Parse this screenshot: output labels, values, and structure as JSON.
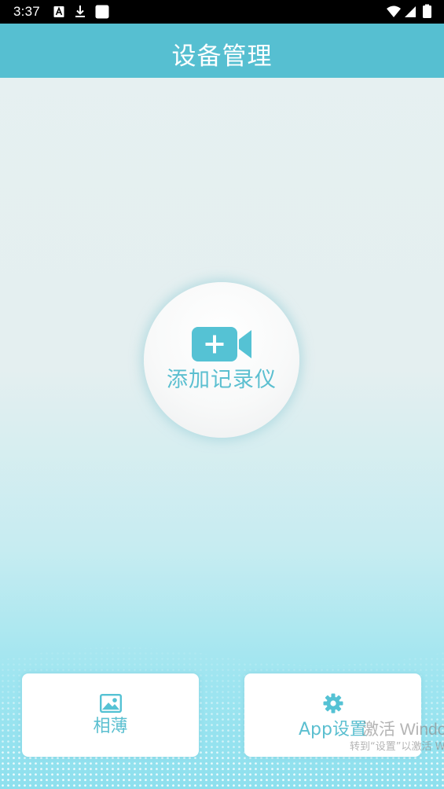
{
  "status_bar": {
    "time": "3:37",
    "left_icons": [
      "font-notification-icon",
      "download-icon",
      "square-notification-icon"
    ],
    "right_icons": [
      "wifi-icon",
      "cellular-signal-icon",
      "battery-icon"
    ]
  },
  "header": {
    "title": "设备管理"
  },
  "add_device": {
    "label": "添加记录仪",
    "icon": "video-camera-add-icon"
  },
  "bottom_nav": {
    "album_label": "相薄",
    "album_icon": "image-icon",
    "settings_label": "App设置",
    "settings_icon": "gear-icon"
  },
  "watermark": {
    "line1": "激活 Windows",
    "line2": "转到“设置”以激活 Windows。"
  },
  "colors": {
    "header_bg": "#56bfd1",
    "accent": "#5bbfd0",
    "status_bar_bg": "#000000"
  }
}
